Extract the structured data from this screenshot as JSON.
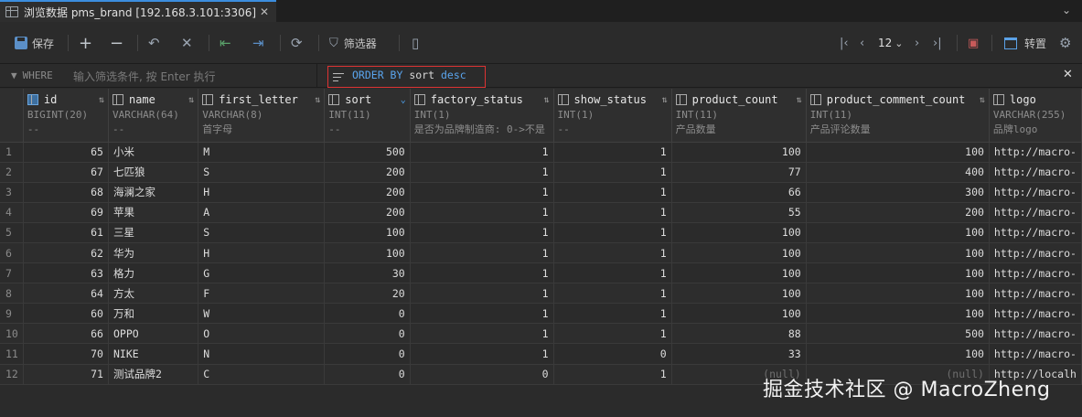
{
  "tab": {
    "title": "浏览数据 pms_brand [192.168.3.101:3306]",
    "close_glyph": "✕",
    "menu_glyph": "⌄"
  },
  "toolbar": {
    "save_label": "保存",
    "filter_label": "筛选器",
    "page_number": "12",
    "transpose_label": "转置"
  },
  "filter": {
    "where_label": "WHERE",
    "where_placeholder": "输入筛选条件, 按 Enter 执行",
    "order_keyword": "ORDER BY",
    "order_column": "sort",
    "order_direction": "desc"
  },
  "columns": [
    {
      "name": "id",
      "type": "BIGINT(20)",
      "comment": "--"
    },
    {
      "name": "name",
      "type": "VARCHAR(64)",
      "comment": "--"
    },
    {
      "name": "first_letter",
      "type": "VARCHAR(8)",
      "comment": "首字母"
    },
    {
      "name": "sort",
      "type": "INT(11)",
      "comment": "--"
    },
    {
      "name": "factory_status",
      "type": "INT(1)",
      "comment": "是否为品牌制造商: 0->不是"
    },
    {
      "name": "show_status",
      "type": "INT(1)",
      "comment": "--"
    },
    {
      "name": "product_count",
      "type": "INT(11)",
      "comment": "产品数量"
    },
    {
      "name": "product_comment_count",
      "type": "INT(11)",
      "comment": "产品评论数量"
    },
    {
      "name": "logo",
      "type": "VARCHAR(255)",
      "comment": "品牌logo"
    }
  ],
  "rows": [
    {
      "rn": "1",
      "id": "65",
      "name": "小米",
      "first_letter": "M",
      "sort": "500",
      "factory_status": "1",
      "show_status": "1",
      "product_count": "100",
      "product_comment_count": "100",
      "logo": "http://macro-"
    },
    {
      "rn": "2",
      "id": "67",
      "name": "七匹狼",
      "first_letter": "S",
      "sort": "200",
      "factory_status": "1",
      "show_status": "1",
      "product_count": "77",
      "product_comment_count": "400",
      "logo": "http://macro-"
    },
    {
      "rn": "3",
      "id": "68",
      "name": "海澜之家",
      "first_letter": "H",
      "sort": "200",
      "factory_status": "1",
      "show_status": "1",
      "product_count": "66",
      "product_comment_count": "300",
      "logo": "http://macro-"
    },
    {
      "rn": "4",
      "id": "69",
      "name": "苹果",
      "first_letter": "A",
      "sort": "200",
      "factory_status": "1",
      "show_status": "1",
      "product_count": "55",
      "product_comment_count": "200",
      "logo": "http://macro-"
    },
    {
      "rn": "5",
      "id": "61",
      "name": "三星",
      "first_letter": "S",
      "sort": "100",
      "factory_status": "1",
      "show_status": "1",
      "product_count": "100",
      "product_comment_count": "100",
      "logo": "http://macro-"
    },
    {
      "rn": "6",
      "id": "62",
      "name": "华为",
      "first_letter": "H",
      "sort": "100",
      "factory_status": "1",
      "show_status": "1",
      "product_count": "100",
      "product_comment_count": "100",
      "logo": "http://macro-"
    },
    {
      "rn": "7",
      "id": "63",
      "name": "格力",
      "first_letter": "G",
      "sort": "30",
      "factory_status": "1",
      "show_status": "1",
      "product_count": "100",
      "product_comment_count": "100",
      "logo": "http://macro-"
    },
    {
      "rn": "8",
      "id": "64",
      "name": "方太",
      "first_letter": "F",
      "sort": "20",
      "factory_status": "1",
      "show_status": "1",
      "product_count": "100",
      "product_comment_count": "100",
      "logo": "http://macro-"
    },
    {
      "rn": "9",
      "id": "60",
      "name": "万和",
      "first_letter": "W",
      "sort": "0",
      "factory_status": "1",
      "show_status": "1",
      "product_count": "100",
      "product_comment_count": "100",
      "logo": "http://macro-"
    },
    {
      "rn": "10",
      "id": "66",
      "name": "OPPO",
      "first_letter": "O",
      "sort": "0",
      "factory_status": "1",
      "show_status": "1",
      "product_count": "88",
      "product_comment_count": "500",
      "logo": "http://macro-"
    },
    {
      "rn": "11",
      "id": "70",
      "name": "NIKE",
      "first_letter": "N",
      "sort": "0",
      "factory_status": "1",
      "show_status": "0",
      "product_count": "33",
      "product_comment_count": "100",
      "logo": "http://macro-"
    },
    {
      "rn": "12",
      "id": "71",
      "name": "测试品牌2",
      "first_letter": "C",
      "sort": "0",
      "factory_status": "0",
      "show_status": "1",
      "product_count": "(null)",
      "product_comment_count": "(null)",
      "logo": "http://localh"
    }
  ],
  "watermark": "掘金技术社区 @ MacroZheng",
  "colors": {
    "accent": "#4ea3f0",
    "highlight_border": "#dd3333",
    "background": "#2b2b2b"
  }
}
